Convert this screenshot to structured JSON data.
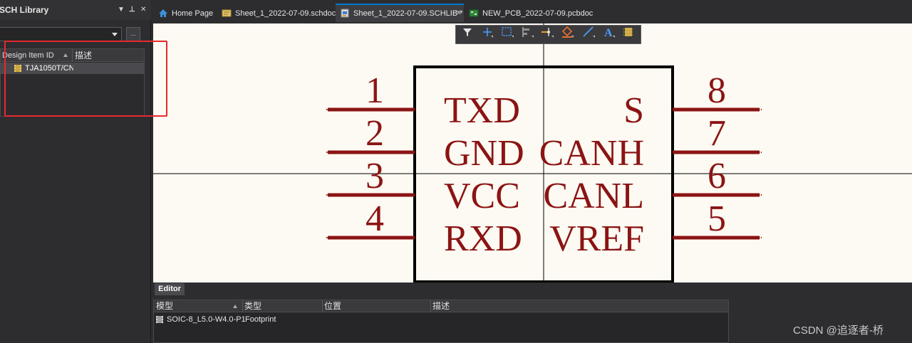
{
  "panel": {
    "title": "SCH Library",
    "controls": {
      "menu": "▼",
      "pin": "⊥",
      "close": "✕"
    },
    "browse_label": "...",
    "table": {
      "columns": [
        "Design Item ID",
        "描述"
      ],
      "rows": [
        {
          "id": "TJA1050T/CN",
          "description": ""
        }
      ]
    }
  },
  "tabs": [
    {
      "label": "Home Page",
      "icon": "home-icon",
      "active": false
    },
    {
      "label": "Sheet_1_2022-07-09.schdoc",
      "icon": "schematic-doc-icon",
      "active": false
    },
    {
      "label": "Sheet_1_2022-07-09.SCHLIB *",
      "icon": "schlib-doc-icon",
      "active": true
    },
    {
      "label": "NEW_PCB_2022-07-09.pcbdoc",
      "icon": "pcb-doc-icon",
      "active": false
    }
  ],
  "active_tab_close": "✕",
  "toolbar": {
    "tools": [
      "filter-icon",
      "add-component-icon",
      "select-rect-icon",
      "align-icon",
      "place-pin-icon",
      "fill-icon",
      "line-icon",
      "text-icon",
      "component-icon"
    ]
  },
  "schematic": {
    "pins_left": [
      {
        "number": "1",
        "name": "TXD"
      },
      {
        "number": "2",
        "name": "GND"
      },
      {
        "number": "3",
        "name": "VCC"
      },
      {
        "number": "4",
        "name": "RXD"
      }
    ],
    "pins_right": [
      {
        "number": "8",
        "name": "S"
      },
      {
        "number": "7",
        "name": "CANH"
      },
      {
        "number": "6",
        "name": "CANL"
      },
      {
        "number": "5",
        "name": "VREF"
      }
    ],
    "colors": {
      "pin": "#8b1414",
      "body": "#000000",
      "background": "#fcfaf2"
    }
  },
  "editor": {
    "tab": "Editor",
    "columns": [
      "模型",
      "类型",
      "位置",
      "描述"
    ],
    "rows": [
      {
        "model": "SOIC-8_L5.0-W4.0-P1",
        "type": "Footprint",
        "location": "",
        "description": ""
      }
    ]
  },
  "watermark": "CSDN @追逐者-桥"
}
